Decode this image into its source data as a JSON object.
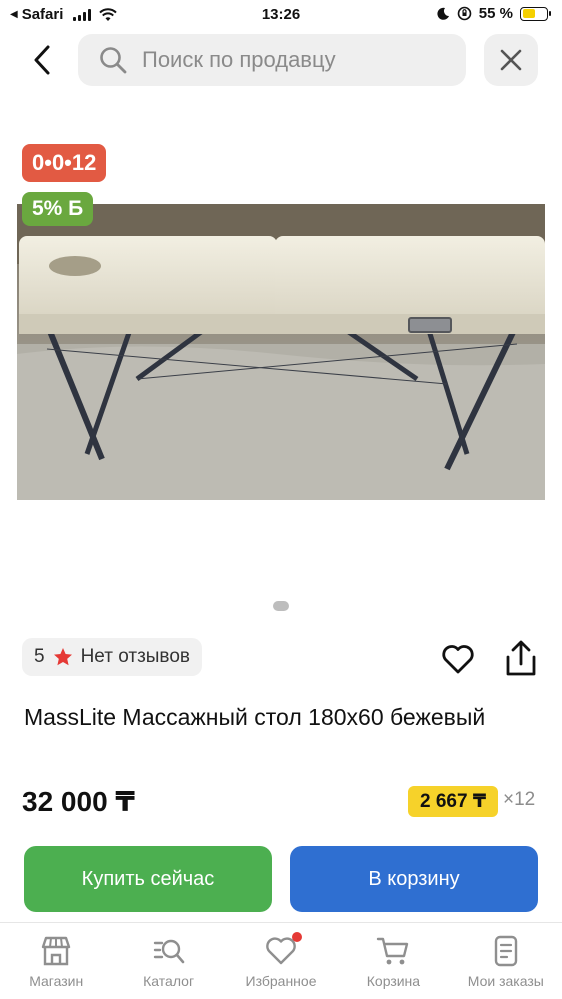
{
  "status_bar": {
    "back_app": "Safari",
    "time": "13:26",
    "battery": "55 %",
    "battery_level": 0.55
  },
  "search": {
    "placeholder": "Поиск по продавцу"
  },
  "product": {
    "badge_installment": "0•0•12",
    "badge_bonus": "5% Б",
    "rating_value": "5",
    "reviews": "Нет отзывов",
    "title": "MassLite Массажный стол 180х60 бежевый",
    "price": "32 000 ₸",
    "installment_price": "2 667 ₸",
    "installment_multiplier": "×12"
  },
  "actions": {
    "buy_now": "Купить сейчас",
    "add_to_cart": "В корзину"
  },
  "bottom_nav": {
    "items": [
      {
        "label": "Магазин",
        "icon": "shop-icon"
      },
      {
        "label": "Каталог",
        "icon": "catalog-search-icon"
      },
      {
        "label": "Избранное",
        "icon": "heart-icon"
      },
      {
        "label": "Корзина",
        "icon": "cart-icon"
      },
      {
        "label": "Мои заказы",
        "icon": "orders-icon"
      }
    ]
  },
  "colors": {
    "installment_badge": "#e25a43",
    "bonus_badge": "#6aa83f",
    "buy_button": "#4caf50",
    "cart_button": "#2f6fd1",
    "installment_highlight": "#f6d22a"
  }
}
